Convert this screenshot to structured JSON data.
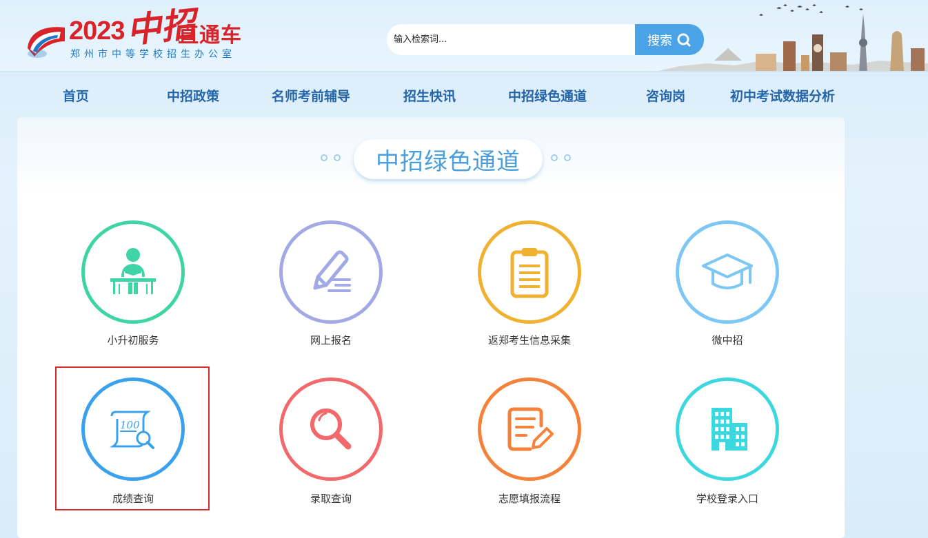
{
  "logo": {
    "year": "2023",
    "highlight": "中招",
    "title": "直通车",
    "subtitle": "郑州市中等学校招生办公室"
  },
  "search": {
    "placeholder": "输入检索词...",
    "button_label": "搜索"
  },
  "nav": [
    {
      "label": "首页"
    },
    {
      "label": "中招政策"
    },
    {
      "label": "名师考前辅导"
    },
    {
      "label": "招生快讯"
    },
    {
      "label": "中招绿色通道"
    },
    {
      "label": "咨询岗"
    },
    {
      "label": "初中考试数据分析"
    }
  ],
  "section": {
    "title": "中招绿色通道"
  },
  "tiles": [
    {
      "label": "小升初服务",
      "icon": "student-desk-icon",
      "color": "#3ed4a6"
    },
    {
      "label": "网上报名",
      "icon": "pen-write-icon",
      "color": "#a3a9e5"
    },
    {
      "label": "返郑考生信息采集",
      "icon": "clipboard-icon",
      "color": "#f0b030"
    },
    {
      "label": "微中招",
      "icon": "graduation-cap-icon",
      "color": "#7cc7f4"
    },
    {
      "label": "成绩查询",
      "icon": "score-search-icon",
      "color": "#3aa1ec",
      "selected": true
    },
    {
      "label": "录取查询",
      "icon": "magnifier-icon",
      "color": "#f2686b"
    },
    {
      "label": "志愿填报流程",
      "icon": "form-edit-icon",
      "color": "#f5823a"
    },
    {
      "label": "学校登录入口",
      "icon": "building-icon",
      "color": "#3cd7df"
    }
  ]
}
